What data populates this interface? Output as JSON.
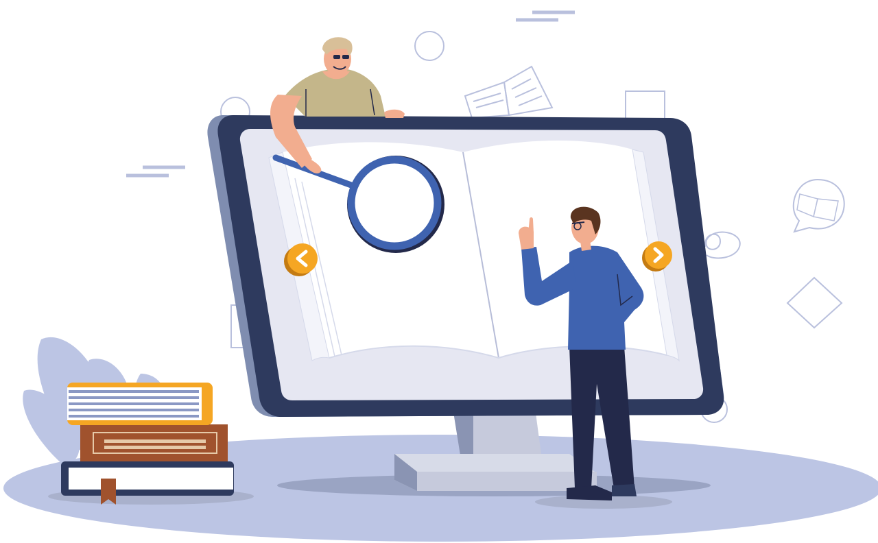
{
  "colors": {
    "monitor_frame": "#2e3a5e",
    "monitor_side": "#7f8db0",
    "screen": "#e6e7f2",
    "book_page": "#ffffff",
    "accent_orange": "#f5a623",
    "shirt_blue": "#3f63b0",
    "trousers_navy": "#23294a",
    "tan_shirt": "#c4b68a",
    "skin": "#f2ad8f",
    "ground": "#bcc5e4",
    "decor_line": "#b9c0dd"
  },
  "icons": {
    "prev": "chevron-left-icon",
    "next": "chevron-right-icon",
    "magnifier": "magnifying-glass-icon",
    "book": "open-book-icon"
  }
}
